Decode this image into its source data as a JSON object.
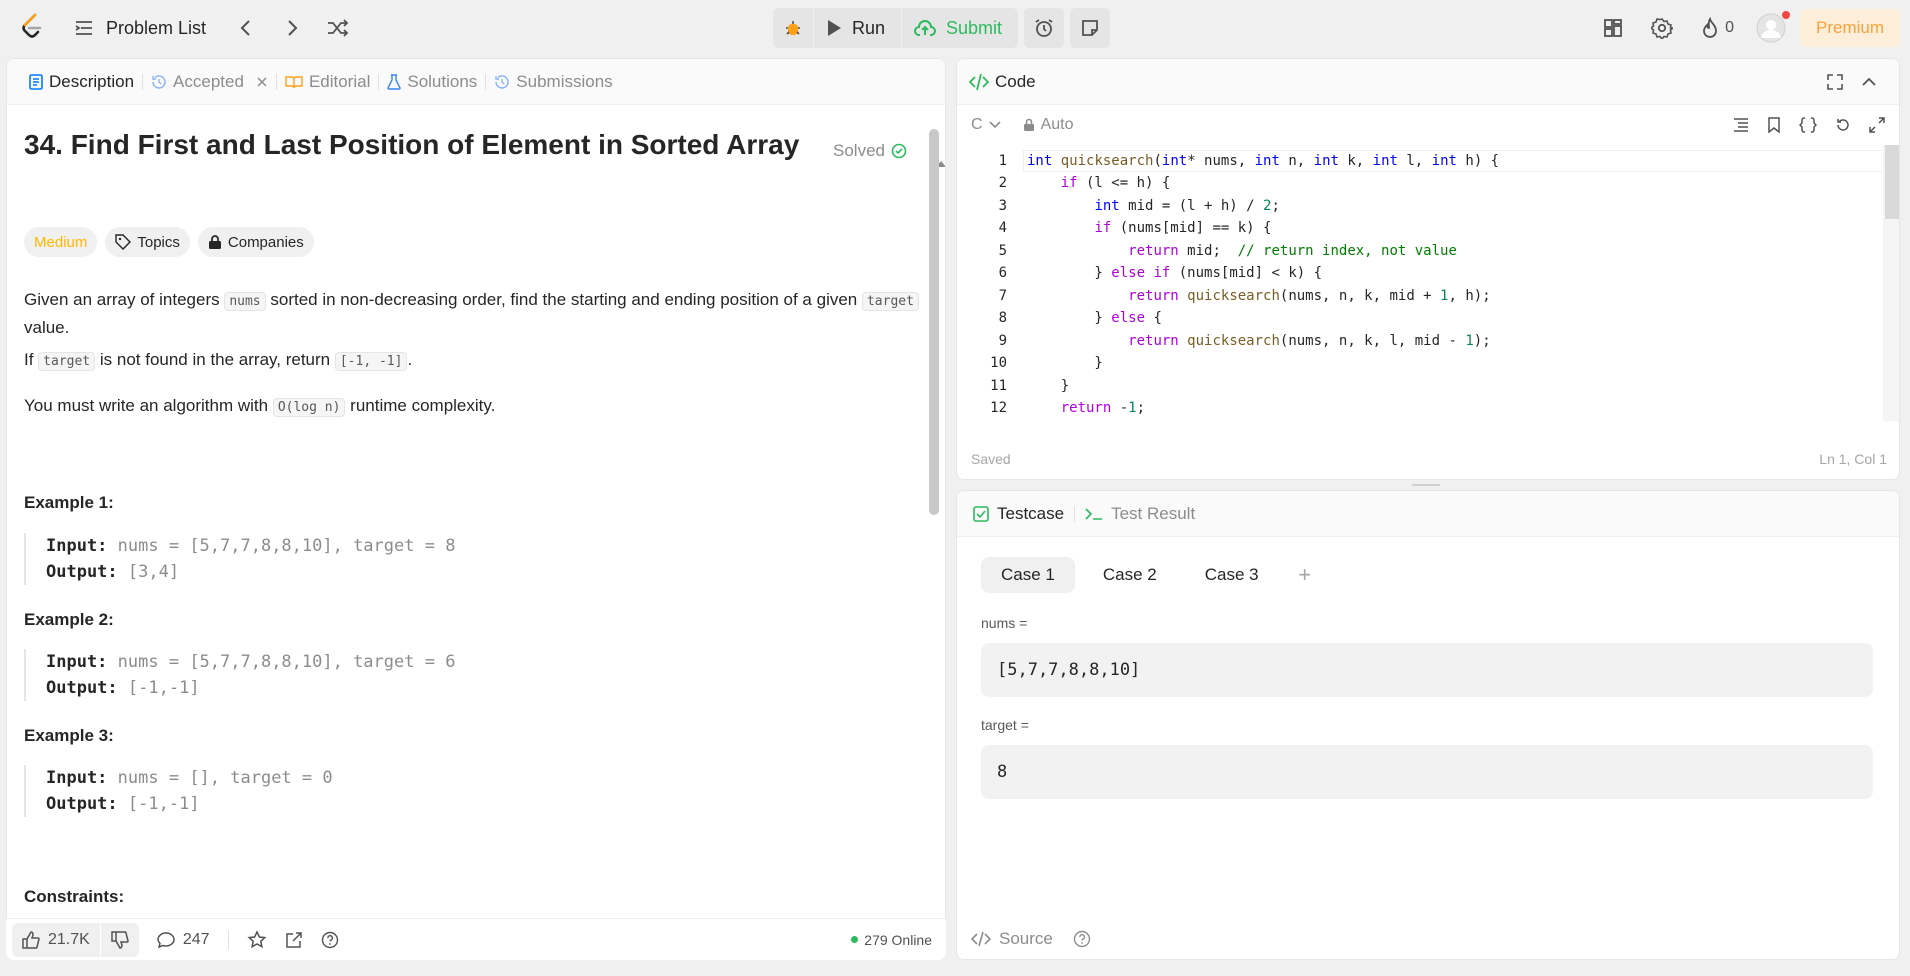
{
  "nav": {
    "problem_list": "Problem List",
    "run": "Run",
    "submit": "Submit",
    "streak_count": "0",
    "premium": "Premium"
  },
  "left_tabs": [
    {
      "label": "Description"
    },
    {
      "label": "Accepted"
    },
    {
      "label": "Editorial"
    },
    {
      "label": "Solutions"
    },
    {
      "label": "Submissions"
    }
  ],
  "problem": {
    "title": "34. Find First and Last Position of Element in Sorted Array",
    "solved": "Solved",
    "difficulty": "Medium",
    "topics": "Topics",
    "companies": "Companies",
    "p1_a": "Given an array of integers ",
    "p1_code1": "nums",
    "p1_b": " sorted in non-decreasing order, find the starting and ending position of a given ",
    "p1_code2": "target",
    "p1_c": " value.",
    "p2_a": "If ",
    "p2_code1": "target",
    "p2_b": " is not found in the array, return ",
    "p2_code2": "[-1, -1]",
    "p2_c": ".",
    "p3_a": "You must write an algorithm with ",
    "p3_code1": "O(log n)",
    "p3_b": " runtime complexity.",
    "examples": [
      {
        "heading": "Example 1:",
        "input_label": "Input:",
        "input": "nums = [5,7,7,8,8,10], target = 8",
        "output_label": "Output:",
        "output": "[3,4]"
      },
      {
        "heading": "Example 2:",
        "input_label": "Input:",
        "input": "nums = [5,7,7,8,8,10], target = 6",
        "output_label": "Output:",
        "output": "[-1,-1]"
      },
      {
        "heading": "Example 3:",
        "input_label": "Input:",
        "input": "nums = [], target = 0",
        "output_label": "Output:",
        "output": "[-1,-1]"
      }
    ],
    "constraints": "Constraints:"
  },
  "left_footer": {
    "likes": "21.7K",
    "comments": "247",
    "online": "279 Online"
  },
  "code": {
    "title": "Code",
    "language": "C",
    "mode": "Auto",
    "status": "Saved",
    "cursor": "Ln 1, Col 1",
    "lines": [
      "1",
      "2",
      "3",
      "4",
      "5",
      "6",
      "7",
      "8",
      "9",
      "10",
      "11",
      "12"
    ]
  },
  "test": {
    "tab_testcase": "Testcase",
    "tab_result": "Test Result",
    "cases": [
      "Case 1",
      "Case 2",
      "Case 3"
    ],
    "add": "+",
    "nums_label": "nums =",
    "nums_value": "[5,7,7,8,8,10]",
    "target_label": "target =",
    "target_value": "8",
    "source": "Source"
  },
  "colors": {
    "accent_green": "#2cbb5d",
    "medium_yellow": "#ffb800",
    "premium_orange": "#f9a23c"
  }
}
